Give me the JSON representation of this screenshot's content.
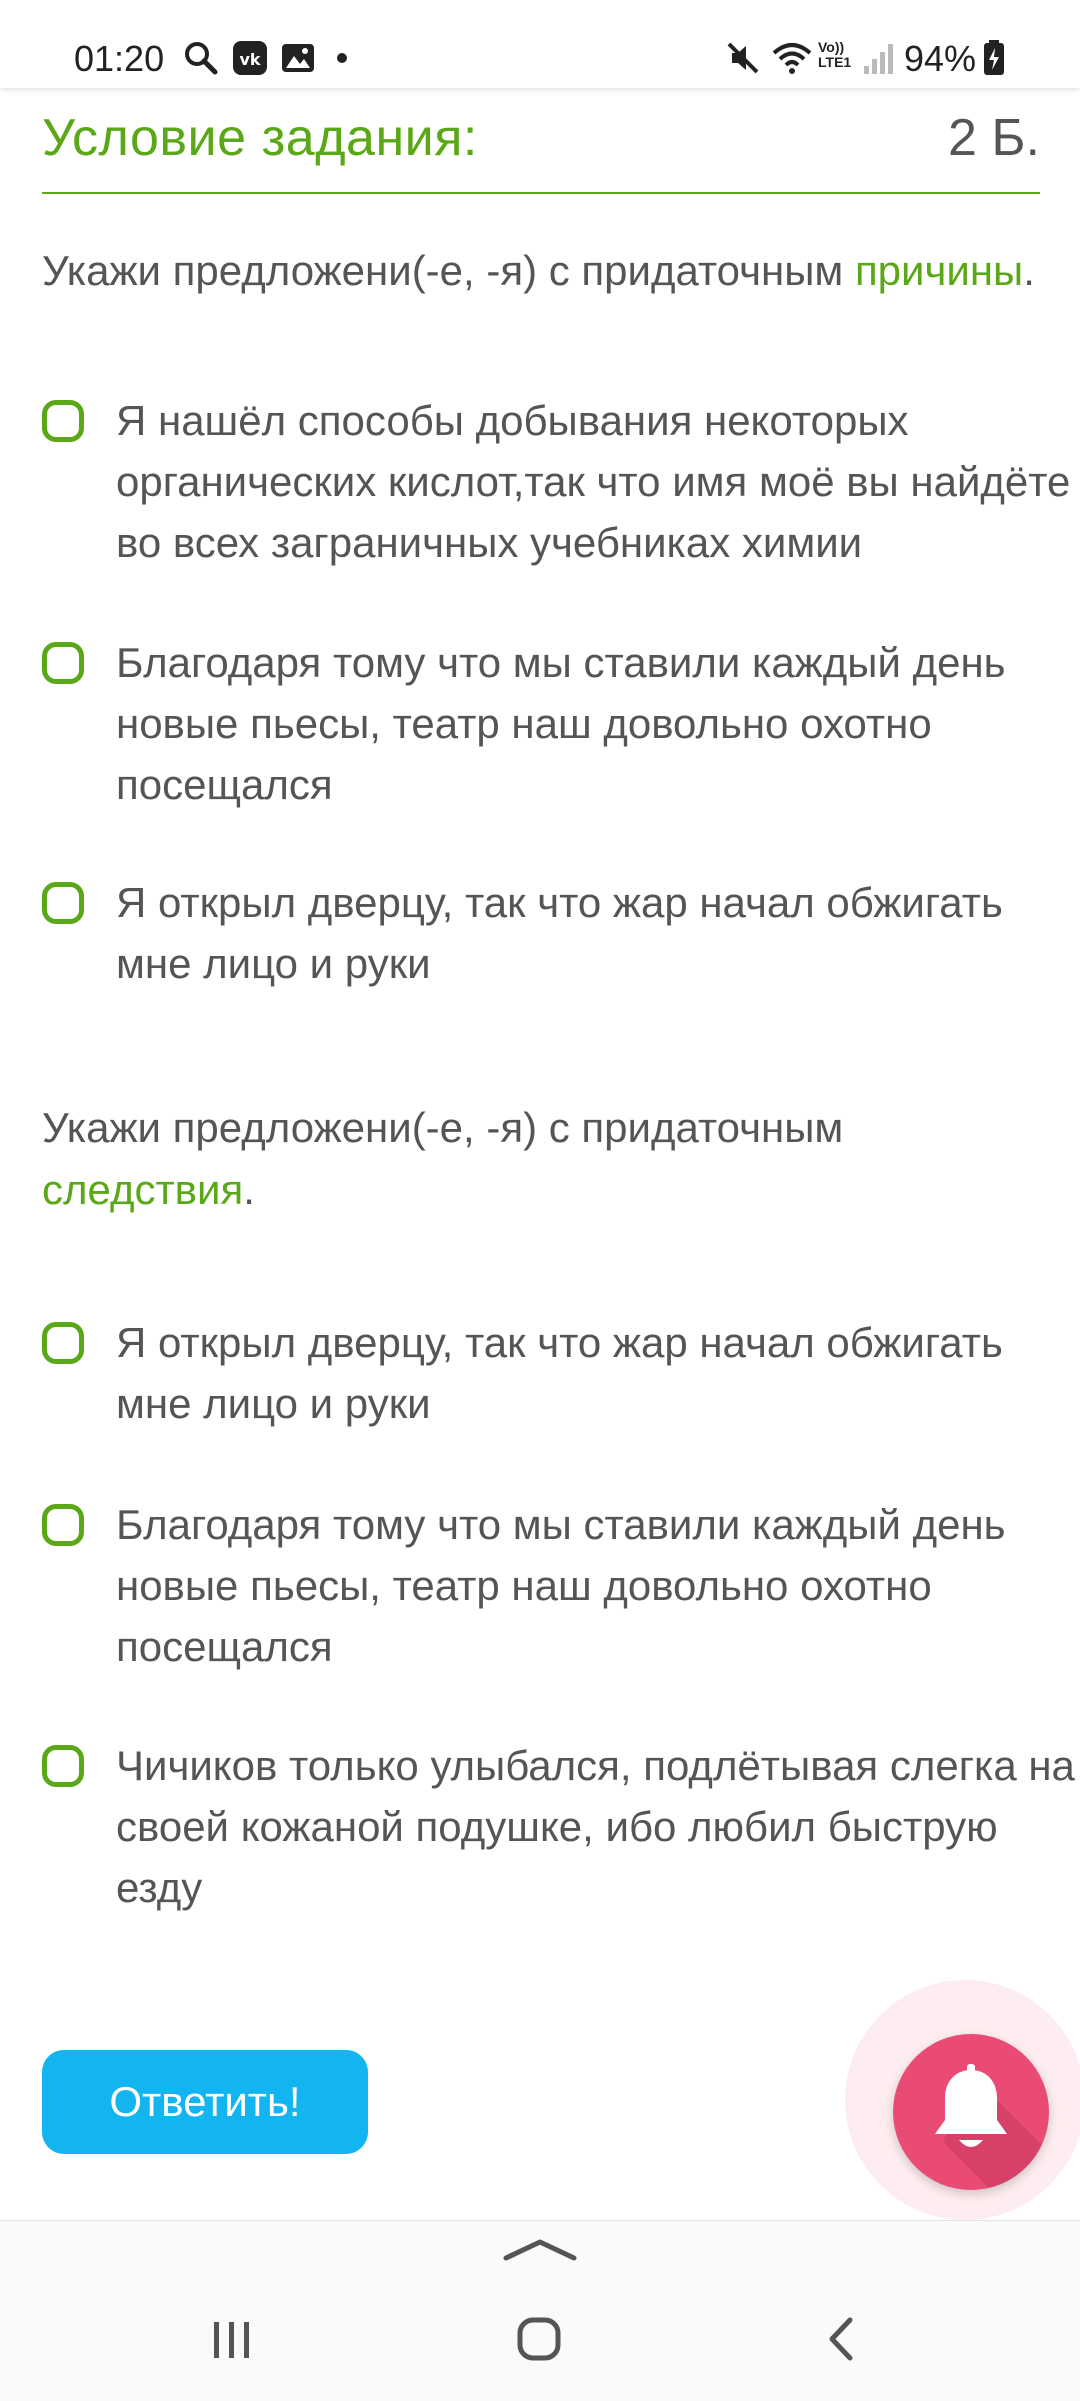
{
  "status_bar": {
    "time": "01:20",
    "battery": "94%",
    "icons": [
      "search-icon",
      "vk-icon",
      "gallery-icon",
      "dot-icon",
      "mute-icon",
      "wifi-icon",
      "volte-icon",
      "signal-icon",
      "battery-icon"
    ],
    "volte_label": "Vo)) LTE1"
  },
  "header": {
    "title": "Условие задания:",
    "points": "2 Б."
  },
  "questions": [
    {
      "prompt_before": "Укажи предложени(-е, -я) с придаточным ",
      "prompt_keyword": "причины",
      "prompt_after": ".",
      "options": [
        {
          "text": "Я нашёл способы добывания некоторых органических кислот,так что имя моё вы найдёте во всех заграничных учебниках химии",
          "checked": false
        },
        {
          "text": "Благодаря тому что мы ставили каждый день новые пьесы, театр наш довольно охотно посещался",
          "checked": false
        },
        {
          "text": "Я открыл дверцу, так что жар начал обжигать мне лицо и руки",
          "checked": false
        }
      ]
    },
    {
      "prompt_before": "Укажи предложени(-е, -я) с придаточным ",
      "prompt_keyword": "следствия",
      "prompt_after": ".",
      "options": [
        {
          "text": "Я открыл дверцу, так что жар начал обжигать мне лицо и руки",
          "checked": false
        },
        {
          "text": "Благодаря тому что мы ставили каждый день новые пьесы, театр наш довольно охотно посещался",
          "checked": false
        },
        {
          "text": "Чичиков только улыбался, подлётывая слегка на своей кожаной подушке, ибо любил быструю езду",
          "checked": false
        }
      ]
    }
  ],
  "answer_button": "Ответить!",
  "colors": {
    "accent_green": "#5aa817",
    "button_blue": "#12b5ef",
    "bell_pink": "#e94b74",
    "text_gray": "#555555"
  }
}
